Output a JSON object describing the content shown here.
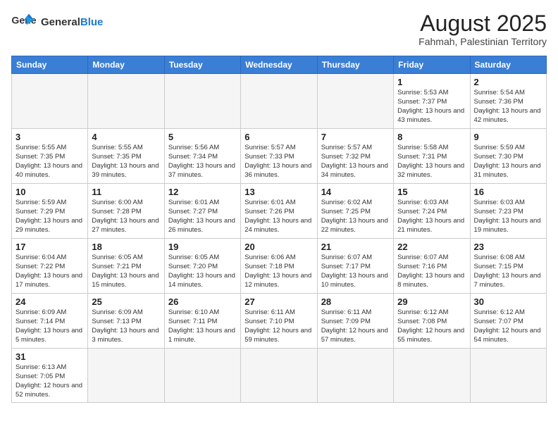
{
  "header": {
    "logo_general": "General",
    "logo_blue": "Blue",
    "month_year": "August 2025",
    "location": "Fahmah, Palestinian Territory"
  },
  "days_of_week": [
    "Sunday",
    "Monday",
    "Tuesday",
    "Wednesday",
    "Thursday",
    "Friday",
    "Saturday"
  ],
  "weeks": [
    [
      {
        "day": "",
        "info": ""
      },
      {
        "day": "",
        "info": ""
      },
      {
        "day": "",
        "info": ""
      },
      {
        "day": "",
        "info": ""
      },
      {
        "day": "",
        "info": ""
      },
      {
        "day": "1",
        "info": "Sunrise: 5:53 AM\nSunset: 7:37 PM\nDaylight: 13 hours and 43 minutes."
      },
      {
        "day": "2",
        "info": "Sunrise: 5:54 AM\nSunset: 7:36 PM\nDaylight: 13 hours and 42 minutes."
      }
    ],
    [
      {
        "day": "3",
        "info": "Sunrise: 5:55 AM\nSunset: 7:35 PM\nDaylight: 13 hours and 40 minutes."
      },
      {
        "day": "4",
        "info": "Sunrise: 5:55 AM\nSunset: 7:35 PM\nDaylight: 13 hours and 39 minutes."
      },
      {
        "day": "5",
        "info": "Sunrise: 5:56 AM\nSunset: 7:34 PM\nDaylight: 13 hours and 37 minutes."
      },
      {
        "day": "6",
        "info": "Sunrise: 5:57 AM\nSunset: 7:33 PM\nDaylight: 13 hours and 36 minutes."
      },
      {
        "day": "7",
        "info": "Sunrise: 5:57 AM\nSunset: 7:32 PM\nDaylight: 13 hours and 34 minutes."
      },
      {
        "day": "8",
        "info": "Sunrise: 5:58 AM\nSunset: 7:31 PM\nDaylight: 13 hours and 32 minutes."
      },
      {
        "day": "9",
        "info": "Sunrise: 5:59 AM\nSunset: 7:30 PM\nDaylight: 13 hours and 31 minutes."
      }
    ],
    [
      {
        "day": "10",
        "info": "Sunrise: 5:59 AM\nSunset: 7:29 PM\nDaylight: 13 hours and 29 minutes."
      },
      {
        "day": "11",
        "info": "Sunrise: 6:00 AM\nSunset: 7:28 PM\nDaylight: 13 hours and 27 minutes."
      },
      {
        "day": "12",
        "info": "Sunrise: 6:01 AM\nSunset: 7:27 PM\nDaylight: 13 hours and 26 minutes."
      },
      {
        "day": "13",
        "info": "Sunrise: 6:01 AM\nSunset: 7:26 PM\nDaylight: 13 hours and 24 minutes."
      },
      {
        "day": "14",
        "info": "Sunrise: 6:02 AM\nSunset: 7:25 PM\nDaylight: 13 hours and 22 minutes."
      },
      {
        "day": "15",
        "info": "Sunrise: 6:03 AM\nSunset: 7:24 PM\nDaylight: 13 hours and 21 minutes."
      },
      {
        "day": "16",
        "info": "Sunrise: 6:03 AM\nSunset: 7:23 PM\nDaylight: 13 hours and 19 minutes."
      }
    ],
    [
      {
        "day": "17",
        "info": "Sunrise: 6:04 AM\nSunset: 7:22 PM\nDaylight: 13 hours and 17 minutes."
      },
      {
        "day": "18",
        "info": "Sunrise: 6:05 AM\nSunset: 7:21 PM\nDaylight: 13 hours and 15 minutes."
      },
      {
        "day": "19",
        "info": "Sunrise: 6:05 AM\nSunset: 7:20 PM\nDaylight: 13 hours and 14 minutes."
      },
      {
        "day": "20",
        "info": "Sunrise: 6:06 AM\nSunset: 7:18 PM\nDaylight: 13 hours and 12 minutes."
      },
      {
        "day": "21",
        "info": "Sunrise: 6:07 AM\nSunset: 7:17 PM\nDaylight: 13 hours and 10 minutes."
      },
      {
        "day": "22",
        "info": "Sunrise: 6:07 AM\nSunset: 7:16 PM\nDaylight: 13 hours and 8 minutes."
      },
      {
        "day": "23",
        "info": "Sunrise: 6:08 AM\nSunset: 7:15 PM\nDaylight: 13 hours and 7 minutes."
      }
    ],
    [
      {
        "day": "24",
        "info": "Sunrise: 6:09 AM\nSunset: 7:14 PM\nDaylight: 13 hours and 5 minutes."
      },
      {
        "day": "25",
        "info": "Sunrise: 6:09 AM\nSunset: 7:13 PM\nDaylight: 13 hours and 3 minutes."
      },
      {
        "day": "26",
        "info": "Sunrise: 6:10 AM\nSunset: 7:11 PM\nDaylight: 13 hours and 1 minute."
      },
      {
        "day": "27",
        "info": "Sunrise: 6:11 AM\nSunset: 7:10 PM\nDaylight: 12 hours and 59 minutes."
      },
      {
        "day": "28",
        "info": "Sunrise: 6:11 AM\nSunset: 7:09 PM\nDaylight: 12 hours and 57 minutes."
      },
      {
        "day": "29",
        "info": "Sunrise: 6:12 AM\nSunset: 7:08 PM\nDaylight: 12 hours and 55 minutes."
      },
      {
        "day": "30",
        "info": "Sunrise: 6:12 AM\nSunset: 7:07 PM\nDaylight: 12 hours and 54 minutes."
      }
    ],
    [
      {
        "day": "31",
        "info": "Sunrise: 6:13 AM\nSunset: 7:05 PM\nDaylight: 12 hours and 52 minutes."
      },
      {
        "day": "",
        "info": ""
      },
      {
        "day": "",
        "info": ""
      },
      {
        "day": "",
        "info": ""
      },
      {
        "day": "",
        "info": ""
      },
      {
        "day": "",
        "info": ""
      },
      {
        "day": "",
        "info": ""
      }
    ]
  ]
}
